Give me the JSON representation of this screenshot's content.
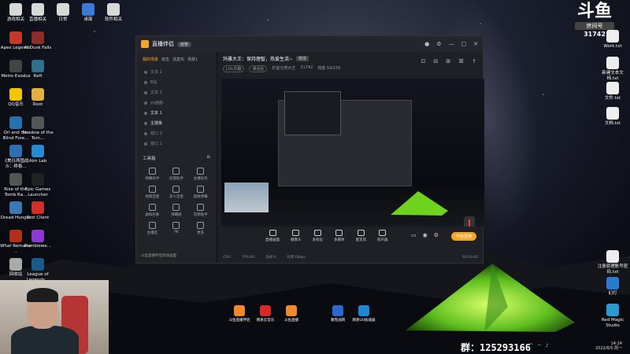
{
  "desktop": {
    "left_icons": [
      {
        "label": "游戏相关",
        "color": "#d8d8d8"
      },
      {
        "label": "直播相关",
        "color": "#d8d8d8"
      },
      {
        "label": "日常",
        "color": "#d8d8d8"
      },
      {
        "label": "桌面",
        "color": "#3a7bd5"
      },
      {
        "label": "软件相关",
        "color": "#d8d8d8"
      },
      {
        "label": "Apex Legends",
        "color": "#c0392b"
      },
      {
        "label": "Ai Dusk Falls",
        "color": "#8e2b2b"
      },
      {
        "label": "Metro Exodus",
        "color": "#444"
      },
      {
        "label": "Raft",
        "color": "#2f6f8f"
      },
      {
        "label": "QQ音乐",
        "color": "#f5c400"
      },
      {
        "label": "Root",
        "color": "#e0b040"
      },
      {
        "label": "Ori and the Blind Fore...",
        "color": "#2a6fb0"
      },
      {
        "label": "Shadow of the Tom...",
        "color": "#555"
      },
      {
        "label": "《美日两国战斗：终极...",
        "color": "#3070b0"
      },
      {
        "label": "Aim Lab",
        "color": "#2a8ad0"
      },
      {
        "label": "Rise of the Tomb Ra...",
        "color": "#555"
      },
      {
        "label": "Epic Games Launcher",
        "color": "#222"
      },
      {
        "label": "Dread Hunger",
        "color": "#3a7ab0"
      },
      {
        "label": "Riot Client",
        "color": "#d0302a"
      },
      {
        "label": "What Remains ...",
        "color": "#b0301a"
      },
      {
        "label": "Rumblewe...",
        "color": "#8a3ad0"
      },
      {
        "label": "回收站",
        "color": "#aaa"
      },
      {
        "label": "League of Legends...",
        "color": "#1a5a8a"
      }
    ],
    "right_icons": [
      {
        "label": "Work.txt",
        "color": "#eee"
      },
      {
        "label": "新建文本文档.txt",
        "color": "#eee"
      },
      {
        "label": "文件.txt",
        "color": "#eee"
      },
      {
        "label": "文档.txt",
        "color": "#eee"
      },
      {
        "label": "注册原理账号密码.txt",
        "color": "#eee"
      },
      {
        "label": "幻灯",
        "color": "#2a7ad0"
      },
      {
        "label": "Red Magic Studio",
        "color": "#2a9ad0"
      }
    ]
  },
  "dy_logo": {
    "mark": "斗鱼",
    "room_label": "房间号",
    "room_id": "31742"
  },
  "app": {
    "title": "直播伴侣",
    "badge": "房管",
    "tabs": [
      "我的场景",
      "双击",
      "话直实",
      "场景1"
    ],
    "scenes": [
      "文本 2",
      "B站",
      "文本 3",
      "yy画面",
      "文本 1",
      "主摄像",
      "窗口 2",
      "窗口 1"
    ],
    "tools_title": "工具箱",
    "tools": [
      "弹幕助手",
      "房管助手",
      "主播任务",
      "视频连麦",
      "多人连麦",
      "超级弹幕",
      "虚拟形象",
      "弹幕姬",
      "音频助手",
      "主播连",
      "PK",
      "更多"
    ],
    "footer": "斗鱼直播伴侣添加画面",
    "stream_title": "玛雅大王：保持理智，热爱生活~",
    "edit_label": "修改",
    "meta": [
      "LOL乐趣",
      "通话狂",
      "护室分类大王",
      "31742",
      "热度 59/155"
    ],
    "bottom_buttons": [
      "直播画面",
      "摄像头",
      "多机位",
      "多媒体",
      "麦克风",
      "扬声器"
    ],
    "volume_value": "100",
    "counter": "125293166",
    "live_button": "开始直播",
    "status": [
      "CPU:",
      "FPS:60",
      "丢帧:0",
      "码率:0kbps"
    ],
    "time": "00:00:00"
  },
  "taskbar_apps": [
    {
      "label": "斗鱼直播伴侣",
      "color": "#f08a2a"
    },
    {
      "label": "网易云音乐",
      "color": "#d42a2a"
    },
    {
      "label": "斗鱼直播",
      "color": "#f08a2a"
    },
    {
      "label": "暴雪战网",
      "color": "#2a6ad0"
    },
    {
      "label": "网易UU加速器",
      "color": "#1a8ad0"
    }
  ],
  "group_text": "群：125293166",
  "clock": {
    "time": "14:24",
    "date": "2022/8/5 周一"
  }
}
